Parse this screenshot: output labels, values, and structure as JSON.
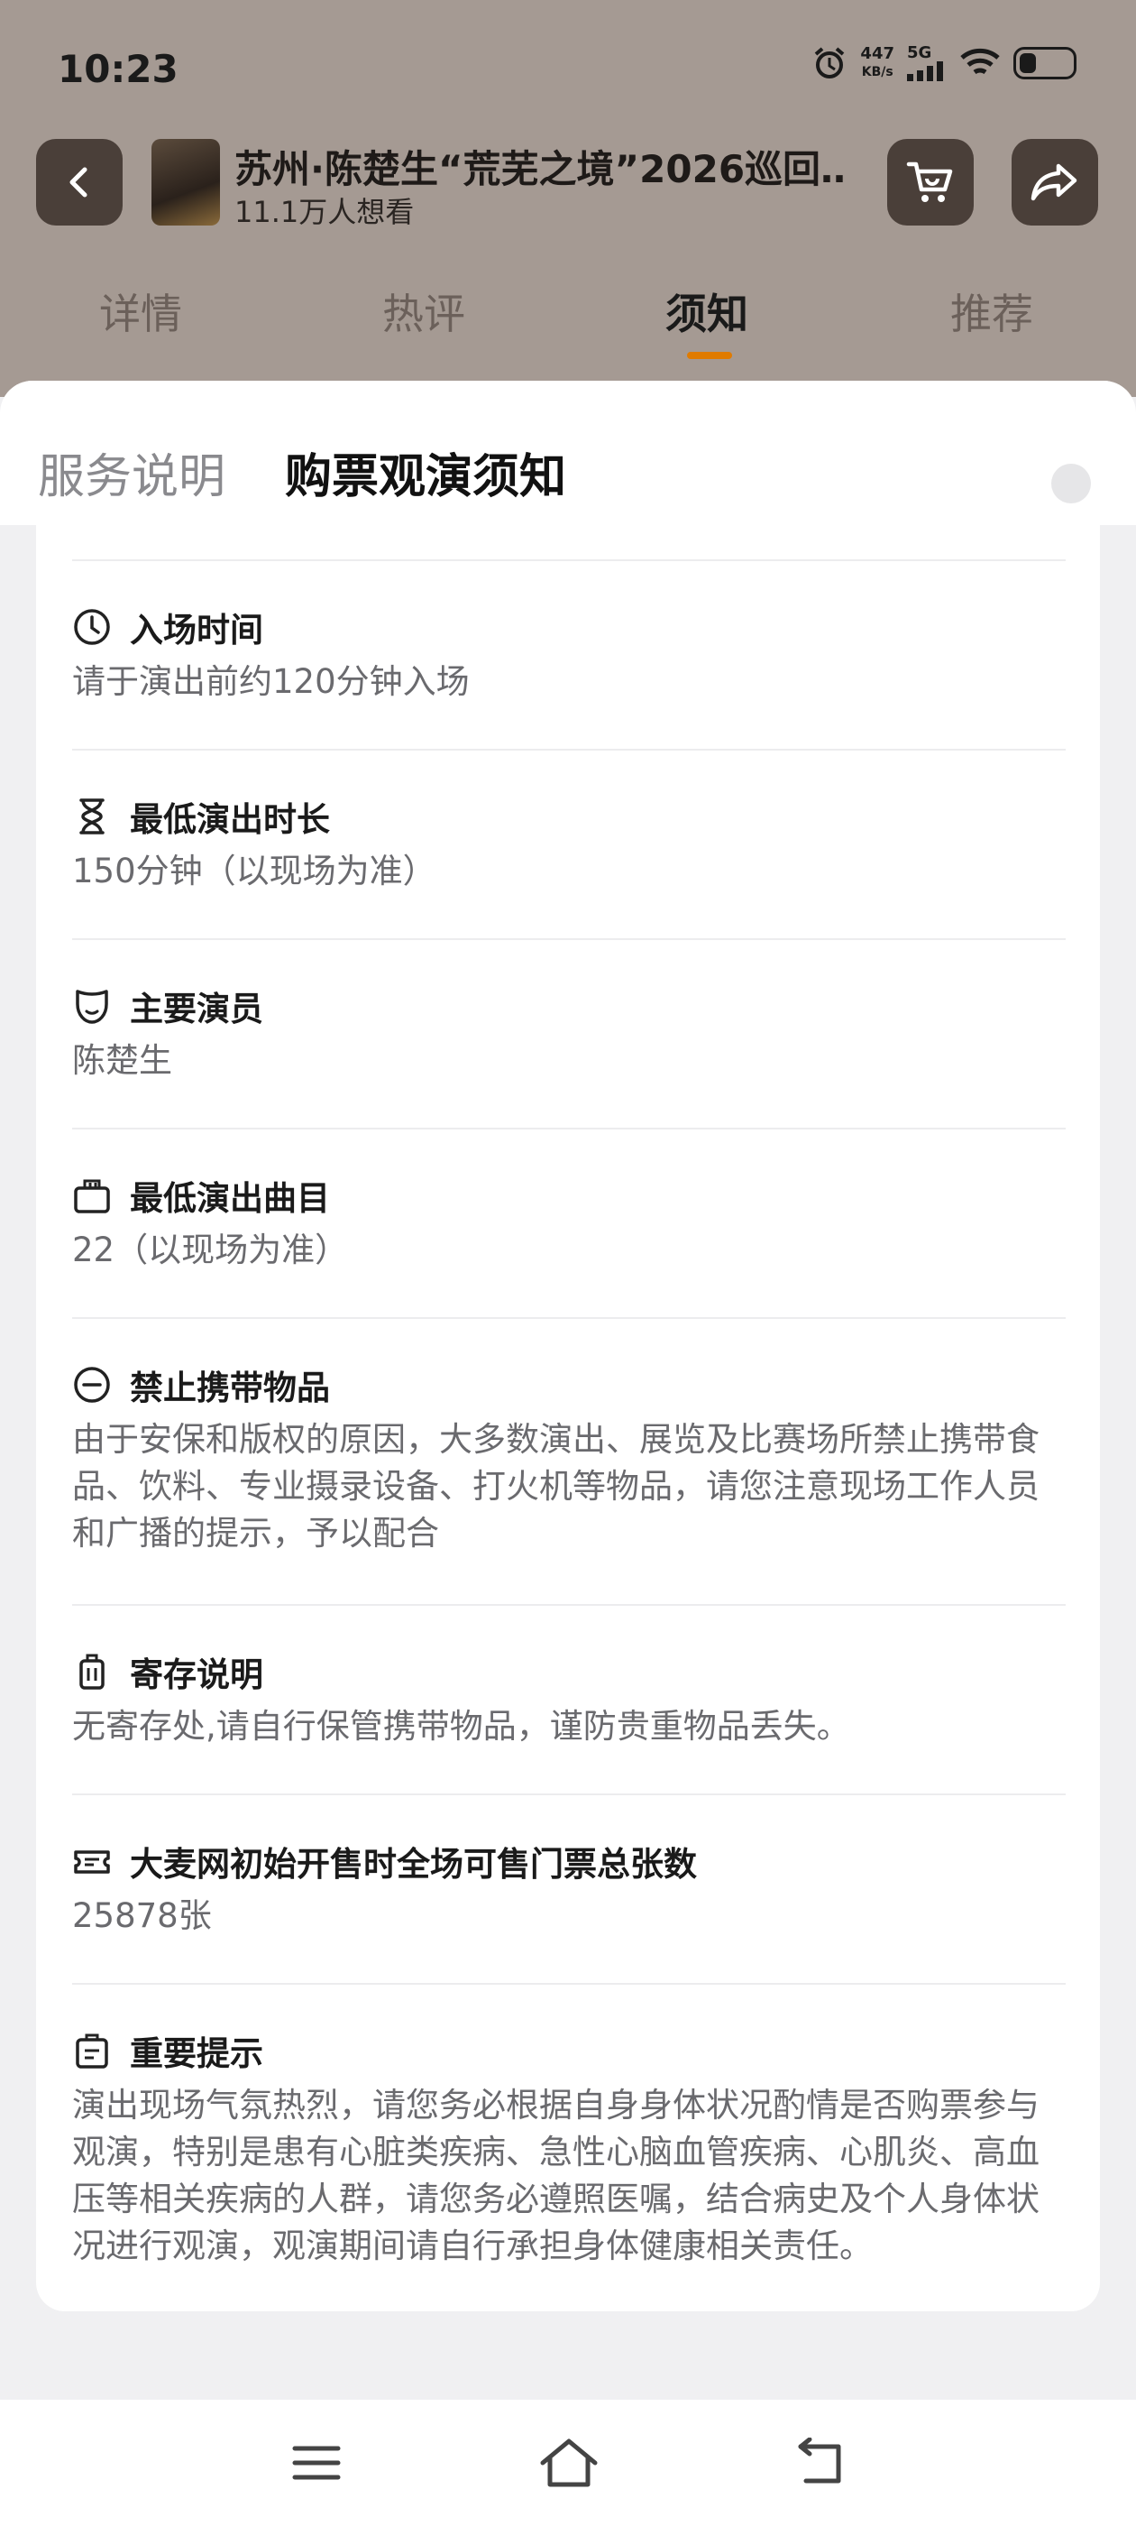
{
  "status_bar": {
    "time": "10:23",
    "speed_value": "447",
    "speed_unit": "KB/s",
    "network": "5G"
  },
  "header": {
    "title": "苏州·陈楚生“荒芜之境”2026巡回…",
    "subtitle": "11.1万人想看"
  },
  "tabs": [
    "详情",
    "热评",
    "须知",
    "推荐"
  ],
  "active_tab_index": 2,
  "sheet": {
    "tabs": [
      "服务说明",
      "购票观演须知"
    ],
    "active_tab_index": 1
  },
  "notice_items": [
    {
      "icon": "clock-icon",
      "title": "入场时间",
      "body": "请于演出前约120分钟入场"
    },
    {
      "icon": "hourglass-icon",
      "title": "最低演出时长",
      "body": "150分钟（以现场为准）"
    },
    {
      "icon": "mask-icon",
      "title": "主要演员",
      "body": "陈楚生"
    },
    {
      "icon": "tickets-icon",
      "title": "最低演出曲目",
      "body": "22（以现场为准）"
    },
    {
      "icon": "minus-circle-icon",
      "title": "禁止携带物品",
      "body": "由于安保和版权的原因，大多数演出、展览及比赛场所禁止携带食品、饮料、专业摄录设备、打火机等物品，请您注意现场工作人员和广播的提示，予以配合"
    },
    {
      "icon": "luggage-icon",
      "title": "寄存说明",
      "body": "无寄存处,请自行保管携带物品，谨防贵重物品丢失。"
    },
    {
      "icon": "ticket-icon",
      "title": "大麦网初始开售时全场可售门票总张数",
      "body": "25878张"
    },
    {
      "icon": "clipboard-icon",
      "title": "重要提示",
      "body": "演出现场气氛热烈，请您务必根据自身身体状况酌情是否购票参与观演，特别是患有心脏类疾病、急性心脑血管疾病、心肌炎、高血压等相关疾病的人群，请您务必遵照医嘱，结合病史及个人身体状况进行观演，观演期间请自行承担身体健康相关责任。"
    }
  ],
  "colors": {
    "accent": "#e07b00",
    "header_bg": "#a59a93",
    "button_bg": "#4a3f39"
  }
}
